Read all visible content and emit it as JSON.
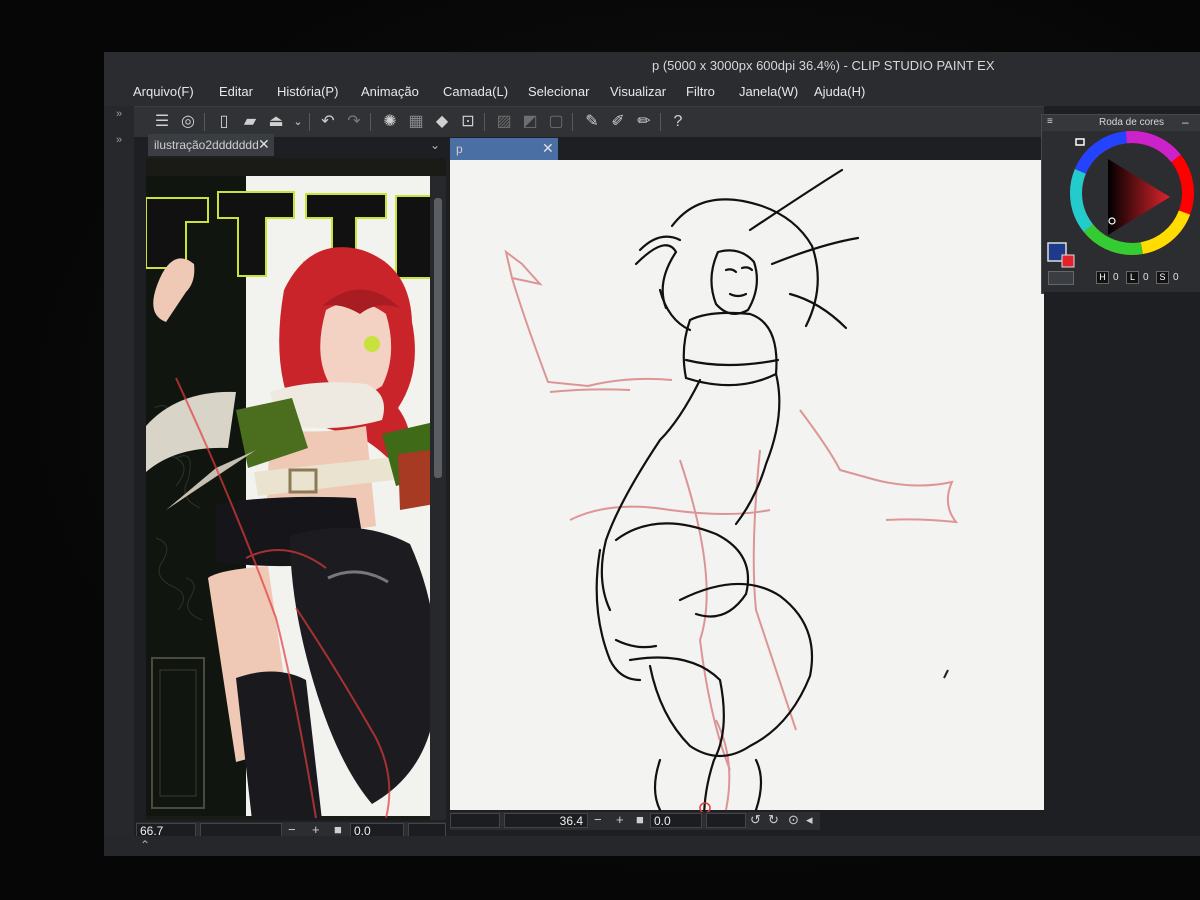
{
  "window": {
    "title": "p (5000 x 3000px 600dpi 36.4%) - CLIP STUDIO PAINT EX"
  },
  "menu": [
    "Arquivo(F)",
    "Editar",
    "História(P)",
    "Animação",
    "Camada(L)",
    "Selecionar",
    "Visualizar",
    "Filtro",
    "Janela(W)",
    "Ajuda(H)"
  ],
  "toolbar": {
    "icons": [
      "menu-icon",
      "clip-studio-icon",
      "new-file-icon",
      "open-file-icon",
      "save-icon",
      "undo-icon",
      "redo-icon",
      "loading-icon",
      "clear-icon",
      "fill-icon",
      "transform-icon",
      "deselect-icon",
      "invert-selection-icon",
      "show-selection-icon",
      "pen-icon",
      "pencil-icon",
      "brush-icon",
      "help-icon"
    ]
  },
  "left_canvas": {
    "tab_label": "ilustração2ddddddd",
    "close_glyph": "✕",
    "zoom_value": "66.7",
    "rotation_value": "0.0"
  },
  "right_canvas": {
    "tab_label": "p",
    "close_glyph": "✕",
    "zoom_value": "36.4",
    "rotation_value": "0.0"
  },
  "status_glyphs": {
    "minus": "−",
    "plus": "+"
  },
  "color_wheel": {
    "title": "Roda de cores",
    "h_label": "H",
    "h_value": "0",
    "s_label": "L",
    "s_value": "0",
    "v_label": "S",
    "v_value": "0",
    "main_color": "#e0232d",
    "sub_color": "#1e3a8a"
  }
}
